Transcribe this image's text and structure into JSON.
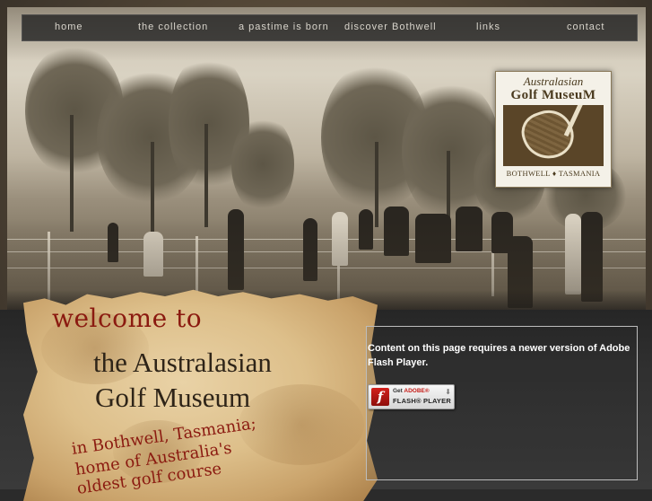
{
  "nav": {
    "items": [
      {
        "label": "home"
      },
      {
        "label": "the collection"
      },
      {
        "label": "a pastime is born"
      },
      {
        "label": "discover Bothwell"
      },
      {
        "label": "links"
      },
      {
        "label": "contact"
      }
    ]
  },
  "logo": {
    "line1": "Australasian",
    "line2": "Golf MuseuM",
    "line3": "BOTHWELL ♦ TASMANIA"
  },
  "hero": {
    "welcome": "welcome to",
    "title_line1": "the Australasian",
    "title_line2": "Golf Museum",
    "sub_line1": "in Bothwell, Tasmania;",
    "sub_line2": "home of Australia's",
    "sub_line3": "oldest golf course"
  },
  "flash": {
    "message": "Content on this page requires a newer version of Adobe Flash Player.",
    "button_get": "Get",
    "button_adobe": "ADOBE®",
    "button_product": "FLASH® PLAYER",
    "button_icon": "f"
  },
  "icons": {
    "flash": "flash-player-icon",
    "download": "download-arrow-icon"
  }
}
